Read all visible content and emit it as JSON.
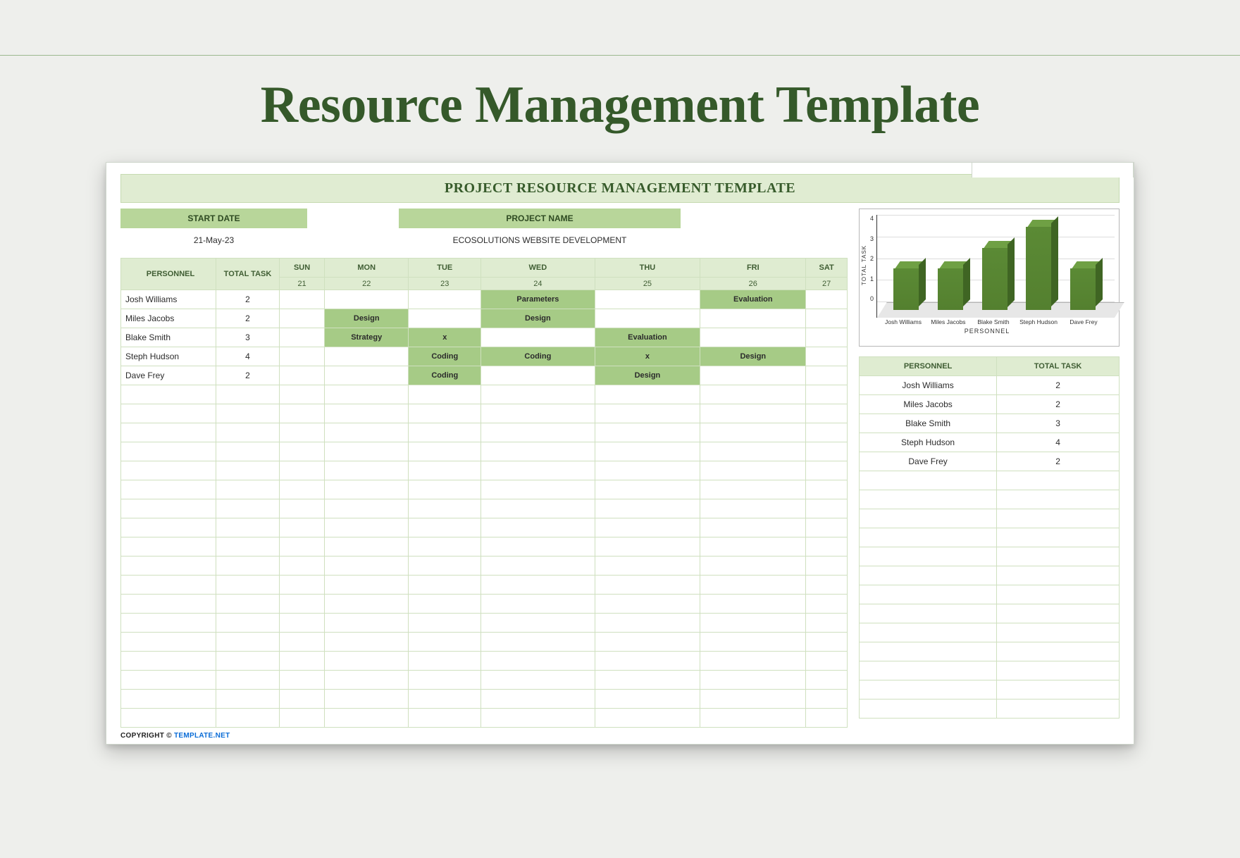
{
  "page_title": "Resource Management Template",
  "banner_title": "PROJECT RESOURCE MANAGEMENT TEMPLATE",
  "meta": {
    "start_date_label": "START DATE",
    "start_date_value": "21-May-23",
    "project_name_label": "PROJECT NAME",
    "project_name_value": "ECOSOLUTIONS WEBSITE DEVELOPMENT"
  },
  "sched_headers": {
    "personnel": "PERSONNEL",
    "total_task": "TOTAL TASK",
    "days": [
      "SUN",
      "MON",
      "TUE",
      "WED",
      "THU",
      "FRI",
      "SAT"
    ],
    "nums": [
      "21",
      "22",
      "23",
      "24",
      "25",
      "26",
      "27"
    ]
  },
  "rows": [
    {
      "name": "Josh Williams",
      "total": "2",
      "cells": [
        "",
        "",
        "",
        "Parameters",
        "",
        "Evaluation",
        ""
      ]
    },
    {
      "name": "Miles Jacobs",
      "total": "2",
      "cells": [
        "",
        "Design",
        "",
        "Design",
        "",
        "",
        ""
      ]
    },
    {
      "name": "Blake Smith",
      "total": "3",
      "cells": [
        "",
        "Strategy",
        "x",
        "",
        "Evaluation",
        "",
        ""
      ]
    },
    {
      "name": "Steph Hudson",
      "total": "4",
      "cells": [
        "",
        "",
        "Coding",
        "Coding",
        "x",
        "Design",
        ""
      ]
    },
    {
      "name": "Dave Frey",
      "total": "2",
      "cells": [
        "",
        "",
        "Coding",
        "",
        "Design",
        "",
        ""
      ]
    }
  ],
  "blank_rows": 18,
  "summary_headers": {
    "personnel": "PERSONNEL",
    "total": "TOTAL TASK"
  },
  "summary_rows": [
    {
      "name": "Josh Williams",
      "total": "2"
    },
    {
      "name": "Miles Jacobs",
      "total": "2"
    },
    {
      "name": "Blake Smith",
      "total": "3"
    },
    {
      "name": "Steph Hudson",
      "total": "4"
    },
    {
      "name": "Dave Frey",
      "total": "2"
    }
  ],
  "summary_blank_rows": 13,
  "copyright": {
    "prefix": "COPYRIGHT ",
    "symbol": "© ",
    "link": "TEMPLATE.NET"
  },
  "chart_data": {
    "type": "bar",
    "categories": [
      "Josh Williams",
      "Miles Jacobs",
      "Blake Smith",
      "Steph Hudson",
      "Dave Frey"
    ],
    "values": [
      2,
      2,
      3,
      4,
      2
    ],
    "ylabel": "TOTAL TASK",
    "xlabel": "PERSONNEL",
    "ylim": [
      0,
      4
    ],
    "yticks": [
      4,
      3,
      2,
      1,
      0
    ]
  }
}
